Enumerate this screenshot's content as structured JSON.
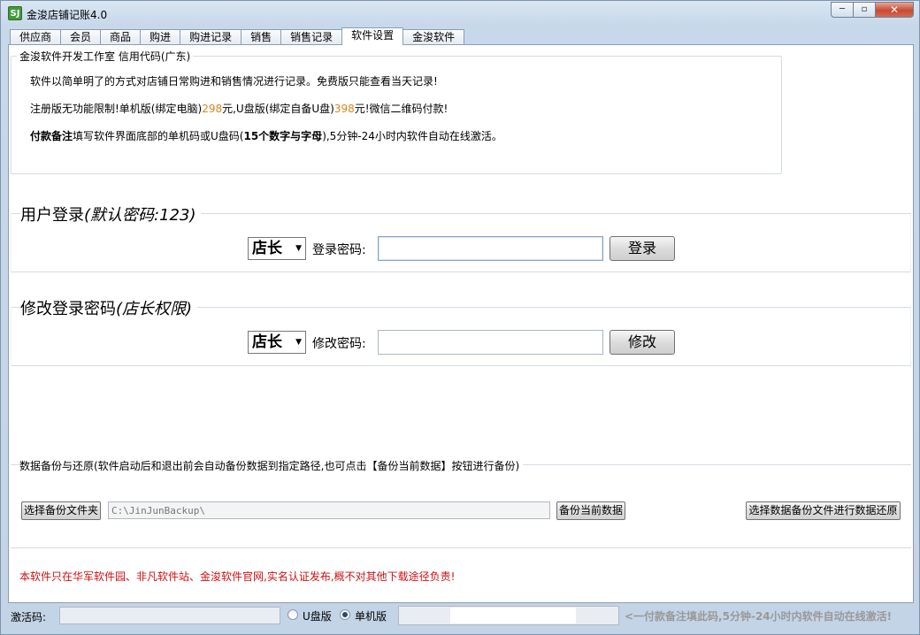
{
  "window": {
    "title": "金浚店铺记账4.0",
    "app_icon_text": "SJ",
    "min_label": "─",
    "max_label": "▫",
    "close_label": "✕"
  },
  "tabs": [
    {
      "label": "供应商"
    },
    {
      "label": "会员"
    },
    {
      "label": "商品"
    },
    {
      "label": "购进"
    },
    {
      "label": "购进记录"
    },
    {
      "label": "销售"
    },
    {
      "label": "销售记录"
    },
    {
      "label": "软件设置",
      "active": true
    },
    {
      "label": "金浚软件"
    }
  ],
  "info": {
    "legend": "金浚软件开发工作室 信用代码(广东)",
    "line1": "软件以简单明了的方式对店铺日常购进和销售情况进行记录。免费版只能查看当天记录!",
    "line2_prefix": "注册版无功能限制!单机版(绑定电脑)",
    "line2_price1": "298",
    "line2_mid": "元,U盘版(绑定自备U盘)",
    "line2_price2": "398",
    "line2_suffix": "元!微信二维码付款!",
    "line3_bold1": "付款备注",
    "line3_mid": "填写软件界面底部的单机码或U盘码(",
    "line3_bold2": "15个数字与字母",
    "line3_suffix": "),5分钟-24小时内软件自动在线激活。"
  },
  "login": {
    "title_prefix": "用户登录",
    "title_paren": "(默认密码:123)",
    "role": "店长",
    "password_label": "登录密码:",
    "password_value": "",
    "button": "登录"
  },
  "change_password": {
    "title_prefix": "修改登录密码",
    "title_paren": "(店长权限)",
    "role": "店长",
    "password_label": "修改密码:",
    "password_value": "",
    "button": "修改"
  },
  "backup": {
    "title": "数据备份与还原(软件启动后和退出前会自动备份数据到指定路径,也可点击【备份当前数据】按钮进行备份)",
    "choose_folder_button": "选择备份文件夹",
    "path": "C:\\JinJunBackup\\",
    "backup_button": "备份当前数据",
    "restore_button": "选择数据备份文件进行数据还原"
  },
  "notice": "本软件只在华军软件园、非凡软件站、金浚软件官网,实名认证发布,概不对其他下载途径负责!",
  "status": {
    "activation_label": "激活码:",
    "activation_value": "",
    "usb_label": "U盘版",
    "pc_label": "单机版",
    "selected": "单机版",
    "hint": "<一付款备注填此码,5分钟-24小时内软件自动在线激活!"
  }
}
